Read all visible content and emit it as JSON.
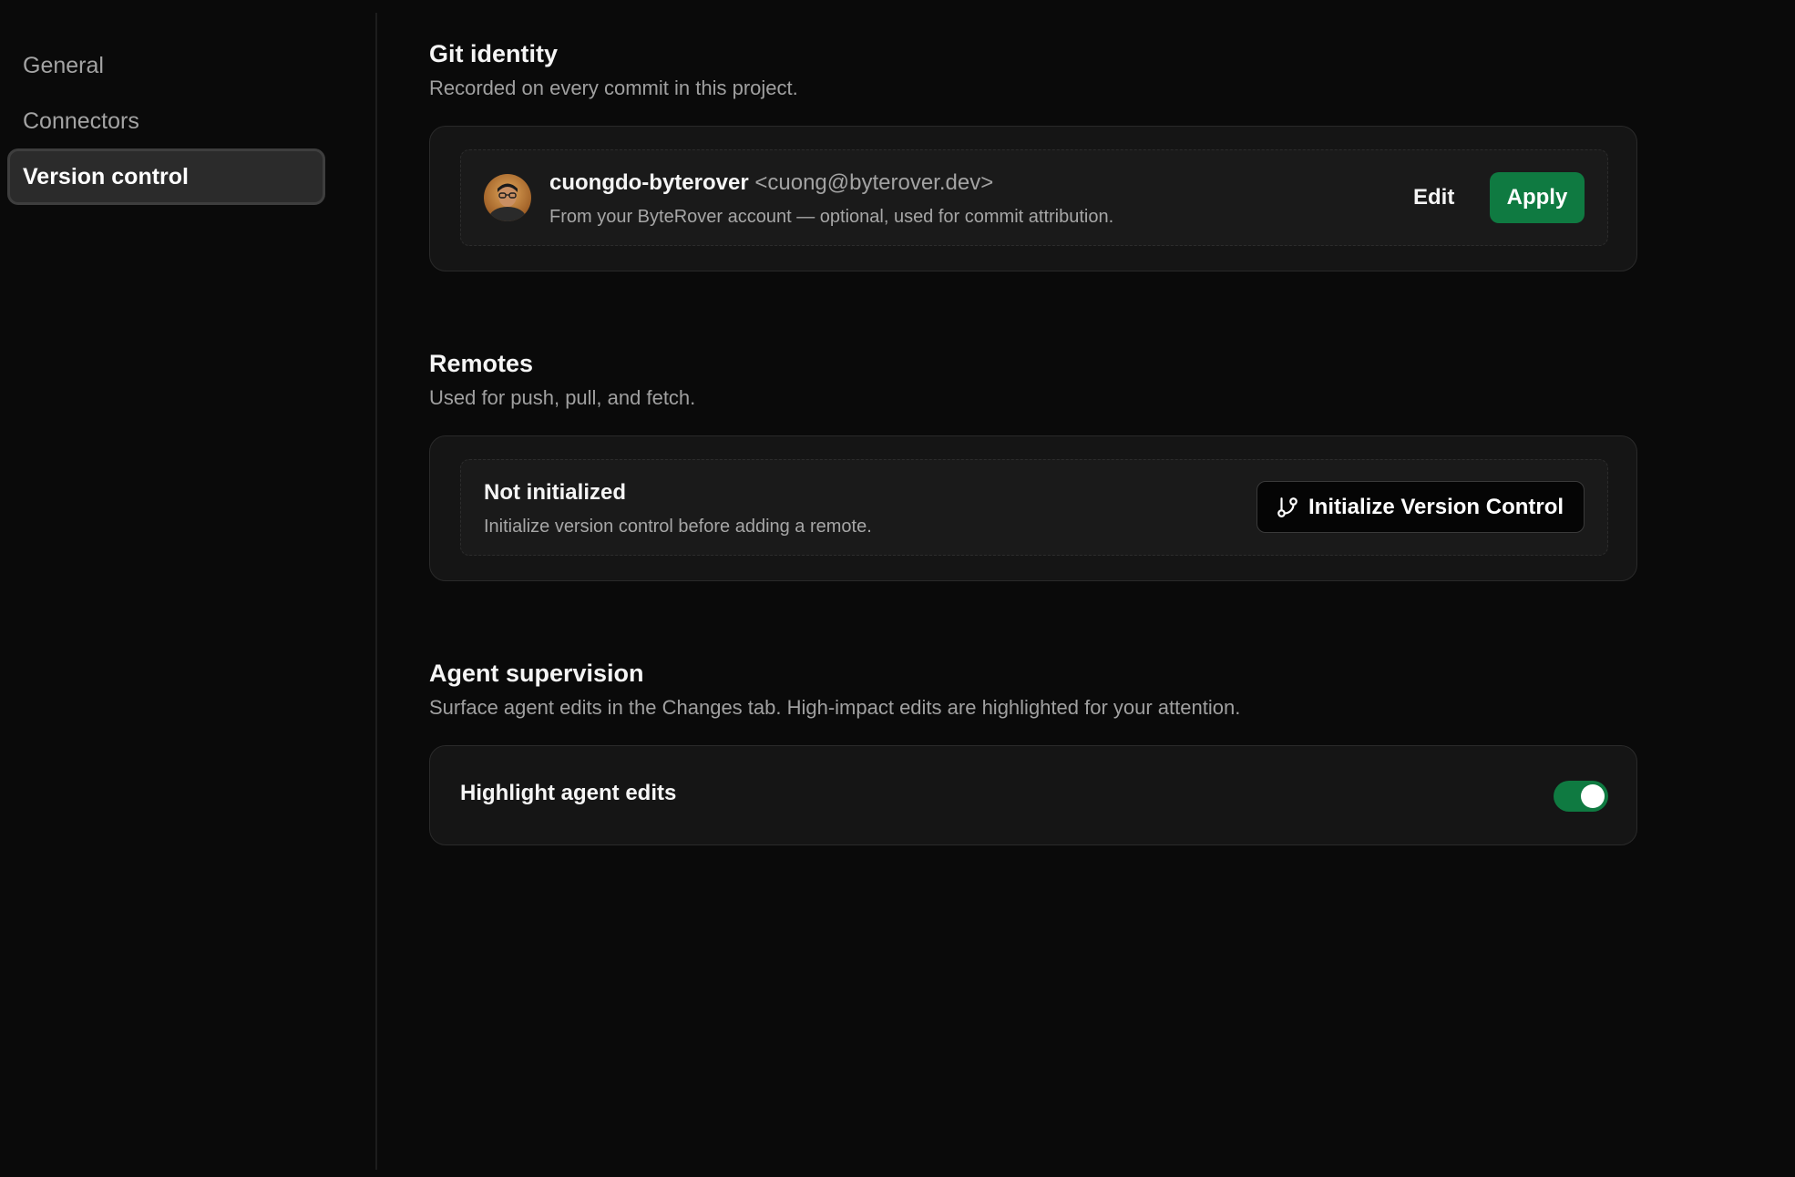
{
  "sidebar": {
    "items": [
      {
        "label": "General",
        "active": false
      },
      {
        "label": "Connectors",
        "active": false
      },
      {
        "label": "Version control",
        "active": true
      }
    ]
  },
  "git_identity": {
    "title": "Git identity",
    "description": "Recorded on every commit in this project.",
    "user_name": "cuongdo-byterover",
    "user_email": "<cuong@byterover.dev>",
    "subtext": "From your ByteRover account — optional, used for commit attribution.",
    "edit_label": "Edit",
    "apply_label": "Apply"
  },
  "remotes": {
    "title": "Remotes",
    "description": "Used for push, pull, and fetch.",
    "status_title": "Not initialized",
    "status_sub": "Initialize version control before adding a remote.",
    "init_button_label": "Initialize Version Control",
    "init_button_icon": "git-branch-icon"
  },
  "agent_supervision": {
    "title": "Agent supervision",
    "description": "Surface agent edits in the Changes tab. High-impact edits are highlighted for your attention.",
    "toggle_label": "Highlight agent edits",
    "toggle_on": true
  },
  "colors": {
    "accent": "#0f7a41",
    "background": "#0a0a0a",
    "card": "#151515"
  }
}
